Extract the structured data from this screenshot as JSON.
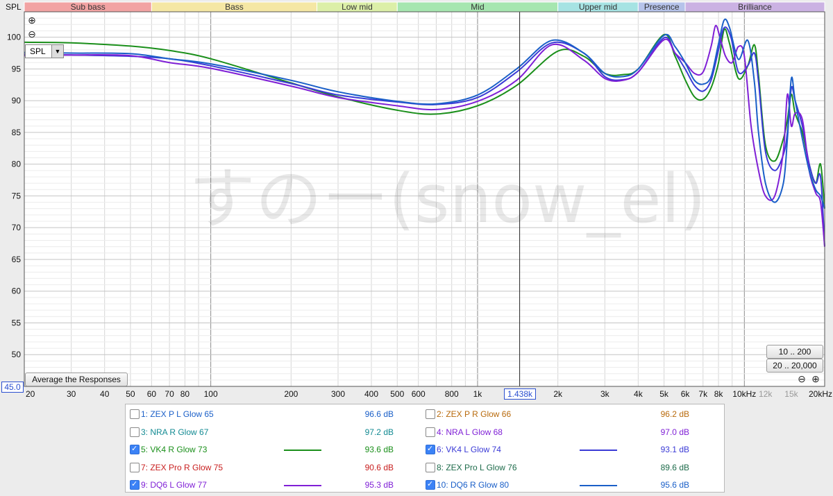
{
  "toolbar": {
    "y_axis_title": "SPL",
    "spl_dropdown": "SPL",
    "zoom_in_icon": "plus-circle-icon",
    "zoom_out_icon": "minus-circle-icon",
    "average_button": "Average the Responses",
    "range_10_200": "10 .. 200",
    "range_20_20000": "20 .. 20,000",
    "y_cursor_readout": "45.0",
    "x_cursor_readout": "1.438k"
  },
  "watermark": "すのー(snow_el)",
  "bands": [
    {
      "label": "Sub bass",
      "from": 20,
      "to": 60,
      "color": "#f2a3a3"
    },
    {
      "label": "Bass",
      "from": 60,
      "to": 250,
      "color": "#f5e7a4"
    },
    {
      "label": "Low mid",
      "from": 250,
      "to": 500,
      "color": "#dcefa8"
    },
    {
      "label": "Mid",
      "from": 500,
      "to": 2000,
      "color": "#a6e6b0"
    },
    {
      "label": "Upper mid",
      "from": 2000,
      "to": 4000,
      "color": "#a6e3e3"
    },
    {
      "label": "Presence",
      "from": 4000,
      "to": 6000,
      "color": "#b6c3ea"
    },
    {
      "label": "Brilliance",
      "from": 6000,
      "to": 20000,
      "color": "#cbb2e3"
    }
  ],
  "chart_data": {
    "type": "line",
    "xscale": "log",
    "xlim": [
      20,
      20000
    ],
    "ylim": [
      45,
      104
    ],
    "grid": true,
    "cursor_x": 1438,
    "ylabel": "SPL",
    "x_ticks": [
      {
        "v": 20,
        "label": "20"
      },
      {
        "v": 30,
        "label": "30"
      },
      {
        "v": 40,
        "label": "40"
      },
      {
        "v": 50,
        "label": "50"
      },
      {
        "v": 60,
        "label": "60"
      },
      {
        "v": 70,
        "label": "70"
      },
      {
        "v": 80,
        "label": "80"
      },
      {
        "v": 100,
        "label": "100"
      },
      {
        "v": 200,
        "label": "200"
      },
      {
        "v": 300,
        "label": "300"
      },
      {
        "v": 400,
        "label": "400"
      },
      {
        "v": 500,
        "label": "500"
      },
      {
        "v": 600,
        "label": "600"
      },
      {
        "v": 800,
        "label": "800"
      },
      {
        "v": 1000,
        "label": "1k"
      },
      {
        "v": 2000,
        "label": "2k"
      },
      {
        "v": 3000,
        "label": "3k"
      },
      {
        "v": 4000,
        "label": "4k"
      },
      {
        "v": 5000,
        "label": "5k"
      },
      {
        "v": 6000,
        "label": "6k"
      },
      {
        "v": 7000,
        "label": "7k"
      },
      {
        "v": 8000,
        "label": "8k"
      },
      {
        "v": 10000,
        "label": "10kHz"
      },
      {
        "v": 12000,
        "label": "12k",
        "dim": true
      },
      {
        "v": 15000,
        "label": "15k",
        "dim": true
      },
      {
        "v": 20000,
        "label": "20kHz"
      }
    ],
    "y_ticks": [
      50,
      55,
      60,
      65,
      70,
      75,
      80,
      85,
      90,
      95,
      100
    ],
    "series": [
      {
        "name": "VK4 R Glow 73",
        "color": "#1a8f1a",
        "points": [
          [
            20,
            99.2
          ],
          [
            30,
            99.1
          ],
          [
            50,
            98.6
          ],
          [
            70,
            97.9
          ],
          [
            100,
            96.6
          ],
          [
            200,
            92.8
          ],
          [
            300,
            90.6
          ],
          [
            500,
            88.5
          ],
          [
            700,
            87.9
          ],
          [
            1000,
            89.2
          ],
          [
            1400,
            92.4
          ],
          [
            2000,
            97.8
          ],
          [
            2500,
            97
          ],
          [
            3000,
            94.3
          ],
          [
            3500,
            94.1
          ],
          [
            4000,
            95
          ],
          [
            5000,
            100.4
          ],
          [
            5500,
            97
          ],
          [
            6000,
            93.3
          ],
          [
            6500,
            90.6
          ],
          [
            7000,
            90.2
          ],
          [
            7500,
            92
          ],
          [
            8000,
            96
          ],
          [
            8400,
            101.2
          ],
          [
            8800,
            99
          ],
          [
            9500,
            93.5
          ],
          [
            10300,
            95.5
          ],
          [
            10900,
            98.8
          ],
          [
            11300,
            94
          ],
          [
            12000,
            83
          ],
          [
            13000,
            80.5
          ],
          [
            14000,
            84
          ],
          [
            14500,
            87
          ],
          [
            15000,
            91
          ],
          [
            15500,
            88
          ],
          [
            16500,
            85
          ],
          [
            17500,
            80
          ],
          [
            18500,
            77
          ],
          [
            19300,
            80
          ],
          [
            20000,
            73
          ]
        ]
      },
      {
        "name": "VK4 L Glow 74",
        "color": "#3a3ad6",
        "points": [
          [
            20,
            97.3
          ],
          [
            30,
            97.2
          ],
          [
            50,
            97
          ],
          [
            70,
            96.6
          ],
          [
            100,
            95.5
          ],
          [
            200,
            92.7
          ],
          [
            300,
            90.9
          ],
          [
            500,
            89.8
          ],
          [
            700,
            89.4
          ],
          [
            1000,
            90.5
          ],
          [
            1400,
            94.5
          ],
          [
            1900,
            99.1
          ],
          [
            2500,
            97.5
          ],
          [
            3000,
            93.8
          ],
          [
            3500,
            93.3
          ],
          [
            4000,
            94.5
          ],
          [
            5000,
            99.9
          ],
          [
            5500,
            97.5
          ],
          [
            6000,
            95
          ],
          [
            6500,
            92.4
          ],
          [
            7000,
            91.5
          ],
          [
            7500,
            93.2
          ],
          [
            8000,
            98
          ],
          [
            8400,
            101.5
          ],
          [
            8900,
            100
          ],
          [
            9500,
            94.5
          ],
          [
            10300,
            95.5
          ],
          [
            10900,
            97.5
          ],
          [
            11300,
            93
          ],
          [
            12000,
            82
          ],
          [
            13000,
            79
          ],
          [
            14000,
            81.5
          ],
          [
            14500,
            85
          ],
          [
            15000,
            92
          ],
          [
            15500,
            90
          ],
          [
            16500,
            86
          ],
          [
            17500,
            80
          ],
          [
            18500,
            77
          ],
          [
            19300,
            78
          ],
          [
            20000,
            67
          ]
        ]
      },
      {
        "name": "DQ6 L Glow 77",
        "color": "#7f1fd6",
        "points": [
          [
            20,
            97.1
          ],
          [
            30,
            97.2
          ],
          [
            50,
            97.1
          ],
          [
            70,
            96
          ],
          [
            100,
            95.1
          ],
          [
            200,
            92.3
          ],
          [
            300,
            90.5
          ],
          [
            500,
            89.2
          ],
          [
            700,
            88.6
          ],
          [
            1000,
            89.9
          ],
          [
            1400,
            93.2
          ],
          [
            1900,
            98.8
          ],
          [
            2500,
            96.4
          ],
          [
            3000,
            93.5
          ],
          [
            3500,
            93.2
          ],
          [
            4000,
            94.5
          ],
          [
            5000,
            99.6
          ],
          [
            5500,
            97.5
          ],
          [
            6000,
            96
          ],
          [
            6500,
            94.3
          ],
          [
            7000,
            94.5
          ],
          [
            7500,
            98.5
          ],
          [
            7800,
            101.8
          ],
          [
            8100,
            100
          ],
          [
            8500,
            97
          ],
          [
            9000,
            96
          ],
          [
            9500,
            98.5
          ],
          [
            10000,
            97
          ],
          [
            10600,
            86
          ],
          [
            11300,
            79
          ],
          [
            12000,
            75
          ],
          [
            13000,
            75
          ],
          [
            14000,
            82
          ],
          [
            14500,
            91
          ],
          [
            15000,
            86
          ],
          [
            15500,
            88
          ],
          [
            16500,
            87
          ],
          [
            17500,
            79
          ],
          [
            18500,
            75.5
          ],
          [
            19300,
            74
          ],
          [
            20000,
            67
          ]
        ]
      },
      {
        "name": "DQ6 R Glow 80",
        "color": "#1a5fc8",
        "points": [
          [
            20,
            97.6
          ],
          [
            30,
            97.5
          ],
          [
            50,
            97.4
          ],
          [
            70,
            96.6
          ],
          [
            100,
            95.8
          ],
          [
            200,
            93.2
          ],
          [
            300,
            91.4
          ],
          [
            500,
            89.9
          ],
          [
            700,
            89.5
          ],
          [
            1000,
            90.9
          ],
          [
            1400,
            95
          ],
          [
            1900,
            99.5
          ],
          [
            2500,
            97.5
          ],
          [
            3000,
            94.3
          ],
          [
            3500,
            93.8
          ],
          [
            4000,
            95
          ],
          [
            5000,
            100.3
          ],
          [
            5500,
            98.5
          ],
          [
            6000,
            96
          ],
          [
            6500,
            93.2
          ],
          [
            7000,
            92.6
          ],
          [
            7500,
            93.8
          ],
          [
            8000,
            99
          ],
          [
            8400,
            102.7
          ],
          [
            8800,
            101.5
          ],
          [
            9500,
            96.5
          ],
          [
            10300,
            99.5
          ],
          [
            10900,
            93
          ],
          [
            11300,
            85
          ],
          [
            12000,
            77
          ],
          [
            13000,
            74
          ],
          [
            14000,
            77
          ],
          [
            14500,
            84
          ],
          [
            15000,
            93.5
          ],
          [
            15500,
            90
          ],
          [
            16500,
            84
          ],
          [
            17500,
            79
          ],
          [
            18500,
            76
          ],
          [
            19300,
            75
          ],
          [
            20000,
            73
          ]
        ]
      }
    ]
  },
  "legend": {
    "items": [
      {
        "index": "1",
        "label": "1: ZEX P L Glow 65",
        "checked": false,
        "value": "96.6 dB",
        "color": "#1a5fc8",
        "shown": false
      },
      {
        "index": "2",
        "label": "2: ZEX P R Glow 66",
        "checked": false,
        "value": "96.2 dB",
        "color": "#b86a0c",
        "shown": false
      },
      {
        "index": "3",
        "label": "3: NRA R Glow 67",
        "checked": false,
        "value": "97.2 dB",
        "color": "#128a92",
        "shown": false
      },
      {
        "index": "4",
        "label": "4: NRA L Glow 68",
        "checked": false,
        "value": "97.0 dB",
        "color": "#7f1fd6",
        "shown": false
      },
      {
        "index": "5",
        "label": "5: VK4 R Glow 73",
        "checked": true,
        "value": "93.6 dB",
        "color": "#1a8f1a",
        "shown": true
      },
      {
        "index": "6",
        "label": "6: VK4 L Glow 74",
        "checked": true,
        "value": "93.1 dB",
        "color": "#3a3ad6",
        "shown": true
      },
      {
        "index": "7",
        "label": "7: ZEX Pro R Glow 75",
        "checked": false,
        "value": "90.6 dB",
        "color": "#c81e1e",
        "shown": false
      },
      {
        "index": "8",
        "label": "8: ZEX Pro L Glow 76",
        "checked": false,
        "value": "89.6 dB",
        "color": "#1d6b4a",
        "shown": false
      },
      {
        "index": "9",
        "label": "9: DQ6 L Glow 77",
        "checked": true,
        "value": "95.3 dB",
        "color": "#7f1fd6",
        "shown": true
      },
      {
        "index": "10",
        "label": "10: DQ6 R Glow 80",
        "checked": true,
        "value": "95.6 dB",
        "color": "#1a5fc8",
        "shown": true
      }
    ]
  }
}
